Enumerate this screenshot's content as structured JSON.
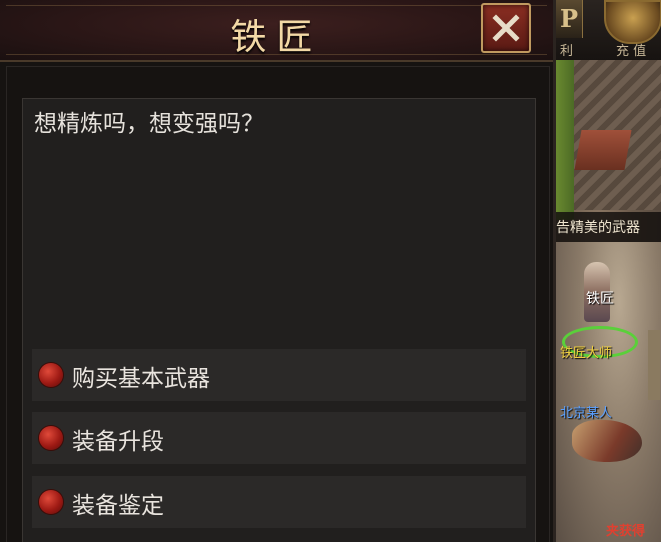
{
  "dialog": {
    "title": "铁匠",
    "close_icon": "close-x-icon",
    "prompt": "想精炼吗，想变强吗？",
    "options": [
      {
        "label": "购买基本武器"
      },
      {
        "label": "装备升段"
      },
      {
        "label": "装备鉴定"
      }
    ]
  },
  "scene": {
    "top_icon_p": "P",
    "top_label_left": "利",
    "top_label_right": "充 值",
    "banner_text": "告精美的武器",
    "npc_name": "铁匠",
    "npc_title": "铁匠大师",
    "guard_name": "北京某人",
    "red_label": "夹获得"
  },
  "colors": {
    "title_text": "#f3d9a6",
    "option_dot": "#c0241a",
    "close_button": "#7a2418",
    "npc_title": "#f0d040",
    "guard_name": "#5aa0ff"
  }
}
